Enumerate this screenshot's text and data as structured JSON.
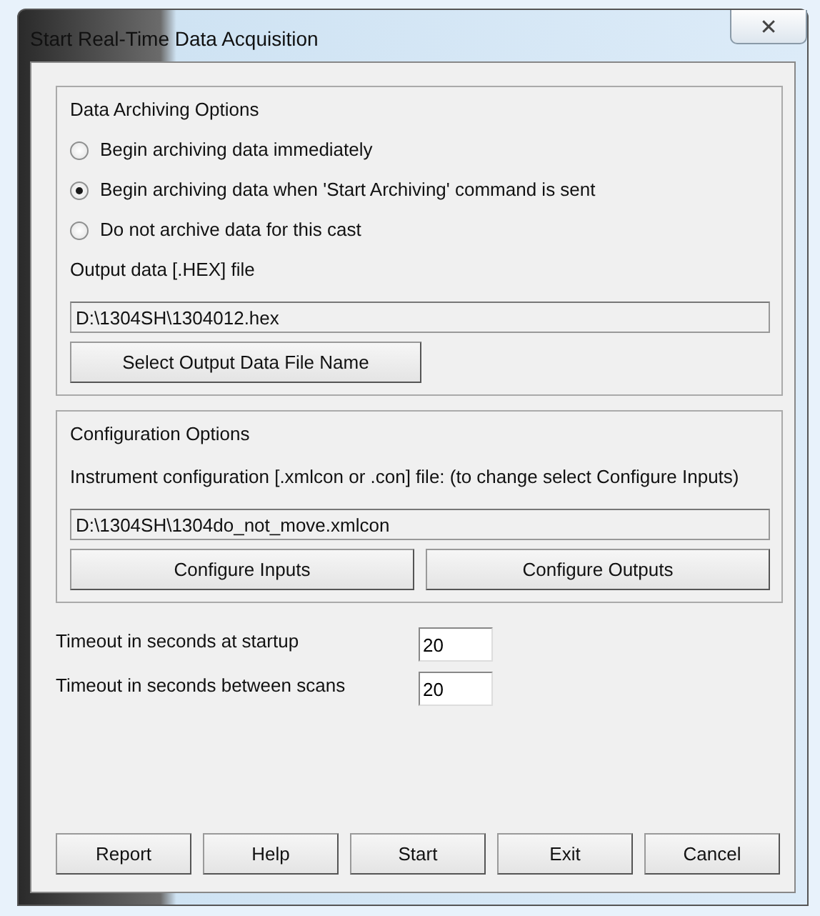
{
  "window": {
    "title": "Start Real-Time Data Acquisition",
    "close": "✕"
  },
  "archiving": {
    "title": "Data Archiving Options",
    "options": [
      {
        "label": "Begin archiving data immediately",
        "selected": false
      },
      {
        "label": "Begin archiving data when 'Start Archiving' command is sent",
        "selected": true
      },
      {
        "label": "Do not archive data for this cast",
        "selected": false
      }
    ],
    "file_label": "Output data [.HEX] file",
    "file_value": "D:\\1304SH\\1304012.hex",
    "select_button": "Select Output Data File Name"
  },
  "configuration": {
    "title": "Configuration Options",
    "file_label": "Instrument configuration [.xmlcon or .con] file: (to change select Configure Inputs)",
    "file_value": "D:\\1304SH\\1304do_not_move.xmlcon",
    "buttons": [
      "Configure Inputs",
      "Configure Outputs"
    ]
  },
  "timeouts": [
    {
      "label": "Timeout in seconds at startup",
      "value": "20"
    },
    {
      "label": "Timeout in seconds between scans",
      "value": "20"
    }
  ],
  "buttons": [
    "Report",
    "Help",
    "Start",
    "Exit",
    "Cancel"
  ]
}
